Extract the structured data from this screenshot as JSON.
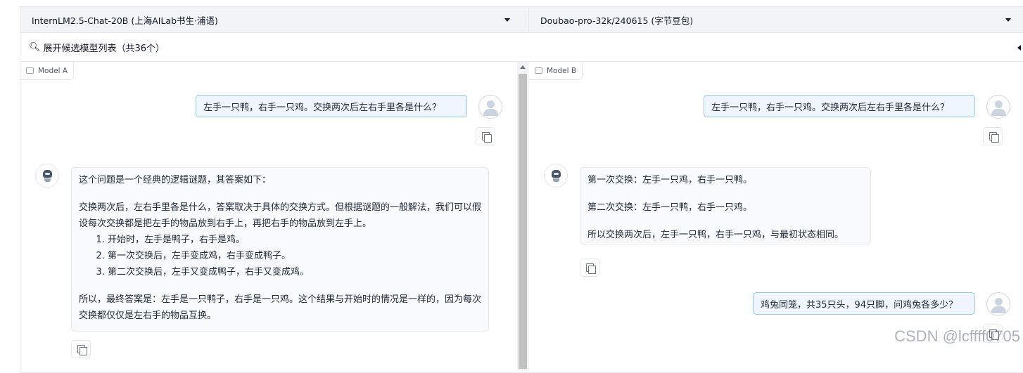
{
  "selectors": {
    "model_a": "InternLM2.5-Chat-20B (上海AILab书生·浦语)",
    "model_b": "Doubao-pro-32k/240615 (字节豆包)"
  },
  "expand_label": "展开候选模型列表（共36个）",
  "panel_a": {
    "label": "Model A",
    "user_message": "左手一只鸭，右手一只鸡。交换两次后左右手里各是什么？",
    "bot_intro": "这个问题是一个经典的逻辑谜题，其答案如下：",
    "bot_para": "交换两次后，左右手里各是什么，答案取决于具体的交换方式。但根据谜题的一般解法，我们可以假设每次交换都是把左手的物品放到右手上，再把右手的物品放到左手上。",
    "bot_list": [
      "开始时，左手是鸭子，右手是鸡。",
      "第一次交换后，左手变成鸡，右手变成鸭子。",
      "第二次交换后，左手又变成鸭子，右手又变成鸡。"
    ],
    "bot_conclusion": "所以，最终答案是：左手是一只鸭子，右手是一只鸡。这个结果与开始时的情况是一样的，因为每次交换都仅仅是左右手的物品互换。"
  },
  "panel_b": {
    "label": "Model B",
    "user_message": "左手一只鸭，右手一只鸡。交换两次后左右手里各是什么？",
    "bot_lines": [
      "第一次交换：左手一只鸡，右手一只鸭。",
      "第二次交换：左手一只鸭，右手一只鸡。",
      "所以交换两次后，左手一只鸭，右手一只鸡，与最初状态相同。"
    ],
    "user_message_2": "鸡兔同笼，共35只头，94只脚，问鸡兔各多少？"
  },
  "watermark": "CSDN @lcffff0705"
}
